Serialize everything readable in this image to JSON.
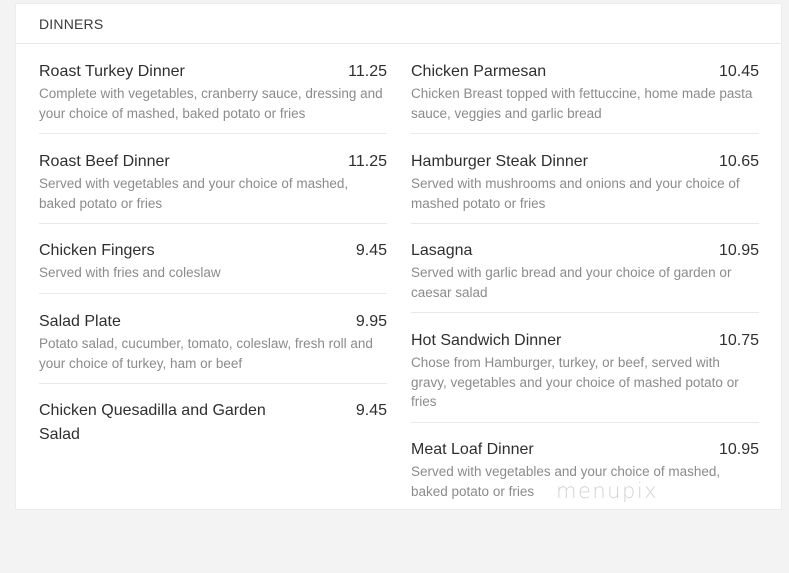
{
  "section": {
    "title": "DINNERS"
  },
  "left_items": [
    {
      "name": "Roast Turkey Dinner",
      "price": "11.25",
      "description": "Complete with vegetables, cranberry sauce, dressing and your choice of mashed, baked potato or fries"
    },
    {
      "name": "Roast Beef Dinner",
      "price": "11.25",
      "description": "Served with vegetables and your choice of mashed, baked potato or fries"
    },
    {
      "name": "Chicken Fingers",
      "price": "9.45",
      "description": "Served with fries and coleslaw"
    },
    {
      "name": "Salad Plate",
      "price": "9.95",
      "description": "Potato salad, cucumber, tomato, coleslaw, fresh roll and your choice of turkey, ham or beef"
    },
    {
      "name": "Chicken Quesadilla and Garden Salad",
      "price": "9.45",
      "description": ""
    }
  ],
  "right_items": [
    {
      "name": "Chicken Parmesan",
      "price": "10.45",
      "description": "Chicken Breast topped with fettuccine, home made pasta sauce, veggies and garlic bread"
    },
    {
      "name": "Hamburger Steak Dinner",
      "price": "10.65",
      "description": "Served with mushrooms and onions and your choice of mashed potato or fries"
    },
    {
      "name": "Lasagna",
      "price": "10.95",
      "description": "Served with garlic bread and your choice of garden or caesar salad"
    },
    {
      "name": "Hot Sandwich Dinner",
      "price": "10.75",
      "description": "Chose from Hamburger, turkey, or beef, served with gravy, vegetables and your choice of mashed potato or fries"
    },
    {
      "name": "Meat Loaf Dinner",
      "price": "10.95",
      "description": "Served with vegetables and your choice of mashed, baked potato or fries"
    }
  ],
  "watermark": {
    "text": "menupix"
  }
}
